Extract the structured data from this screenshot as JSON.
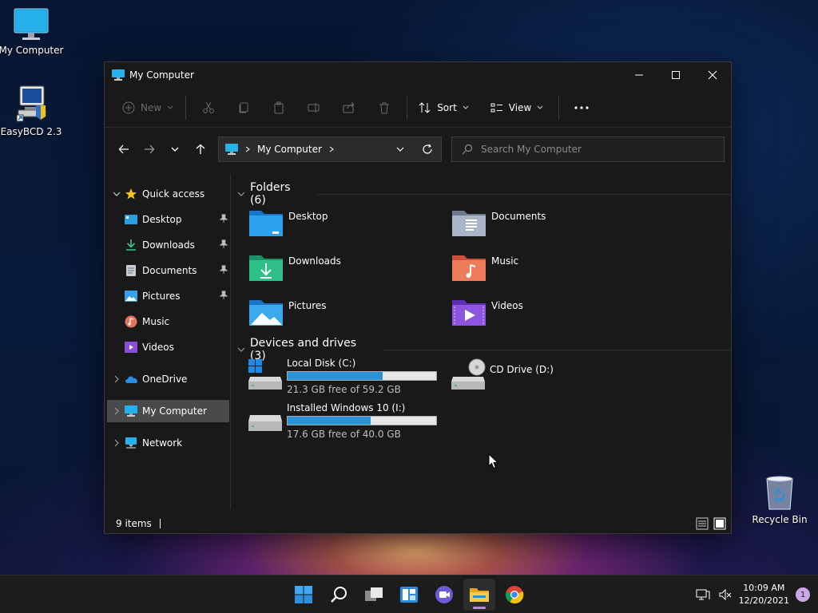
{
  "desktop": {
    "icons": [
      {
        "label": "My Computer"
      },
      {
        "label": "EasyBCD 2.3"
      },
      {
        "label": "Recycle Bin"
      }
    ]
  },
  "window": {
    "title": "My Computer",
    "controls": {
      "minimize": "minimize",
      "maximize": "maximize",
      "close": "close"
    }
  },
  "toolbar": {
    "new_label": "New",
    "sort_label": "Sort",
    "view_label": "View"
  },
  "navbar": {
    "address": "My Computer",
    "search_placeholder": "Search My Computer"
  },
  "sidebar": {
    "quick_access": "Quick access",
    "items": [
      {
        "label": "Desktop"
      },
      {
        "label": "Downloads"
      },
      {
        "label": "Documents"
      },
      {
        "label": "Pictures"
      },
      {
        "label": "Music"
      },
      {
        "label": "Videos"
      }
    ],
    "onedrive": "OneDrive",
    "mycomputer": "My Computer",
    "network": "Network"
  },
  "content": {
    "folders_header": "Folders (6)",
    "folders": [
      {
        "label": "Desktop"
      },
      {
        "label": "Documents"
      },
      {
        "label": "Downloads"
      },
      {
        "label": "Music"
      },
      {
        "label": "Pictures"
      },
      {
        "label": "Videos"
      }
    ],
    "drives_header": "Devices and drives (3)",
    "drives": [
      {
        "label": "Local Disk (C:)",
        "free": "21.3 GB free of 59.2 GB",
        "used_fraction": 0.64
      },
      {
        "label": "CD Drive (D:)"
      },
      {
        "label": "Installed Windows 10 (I:)",
        "free": "17.6 GB free of 40.0 GB",
        "used_fraction": 0.56
      }
    ]
  },
  "status": {
    "count": "9 items"
  },
  "taskbar": {
    "time": "10:09 AM",
    "date": "12/20/2021",
    "notifications": "1"
  },
  "colors": {
    "accent": "#2a93d8",
    "window_bg": "#191919",
    "taskbar_bg": "#1c1c1c"
  }
}
